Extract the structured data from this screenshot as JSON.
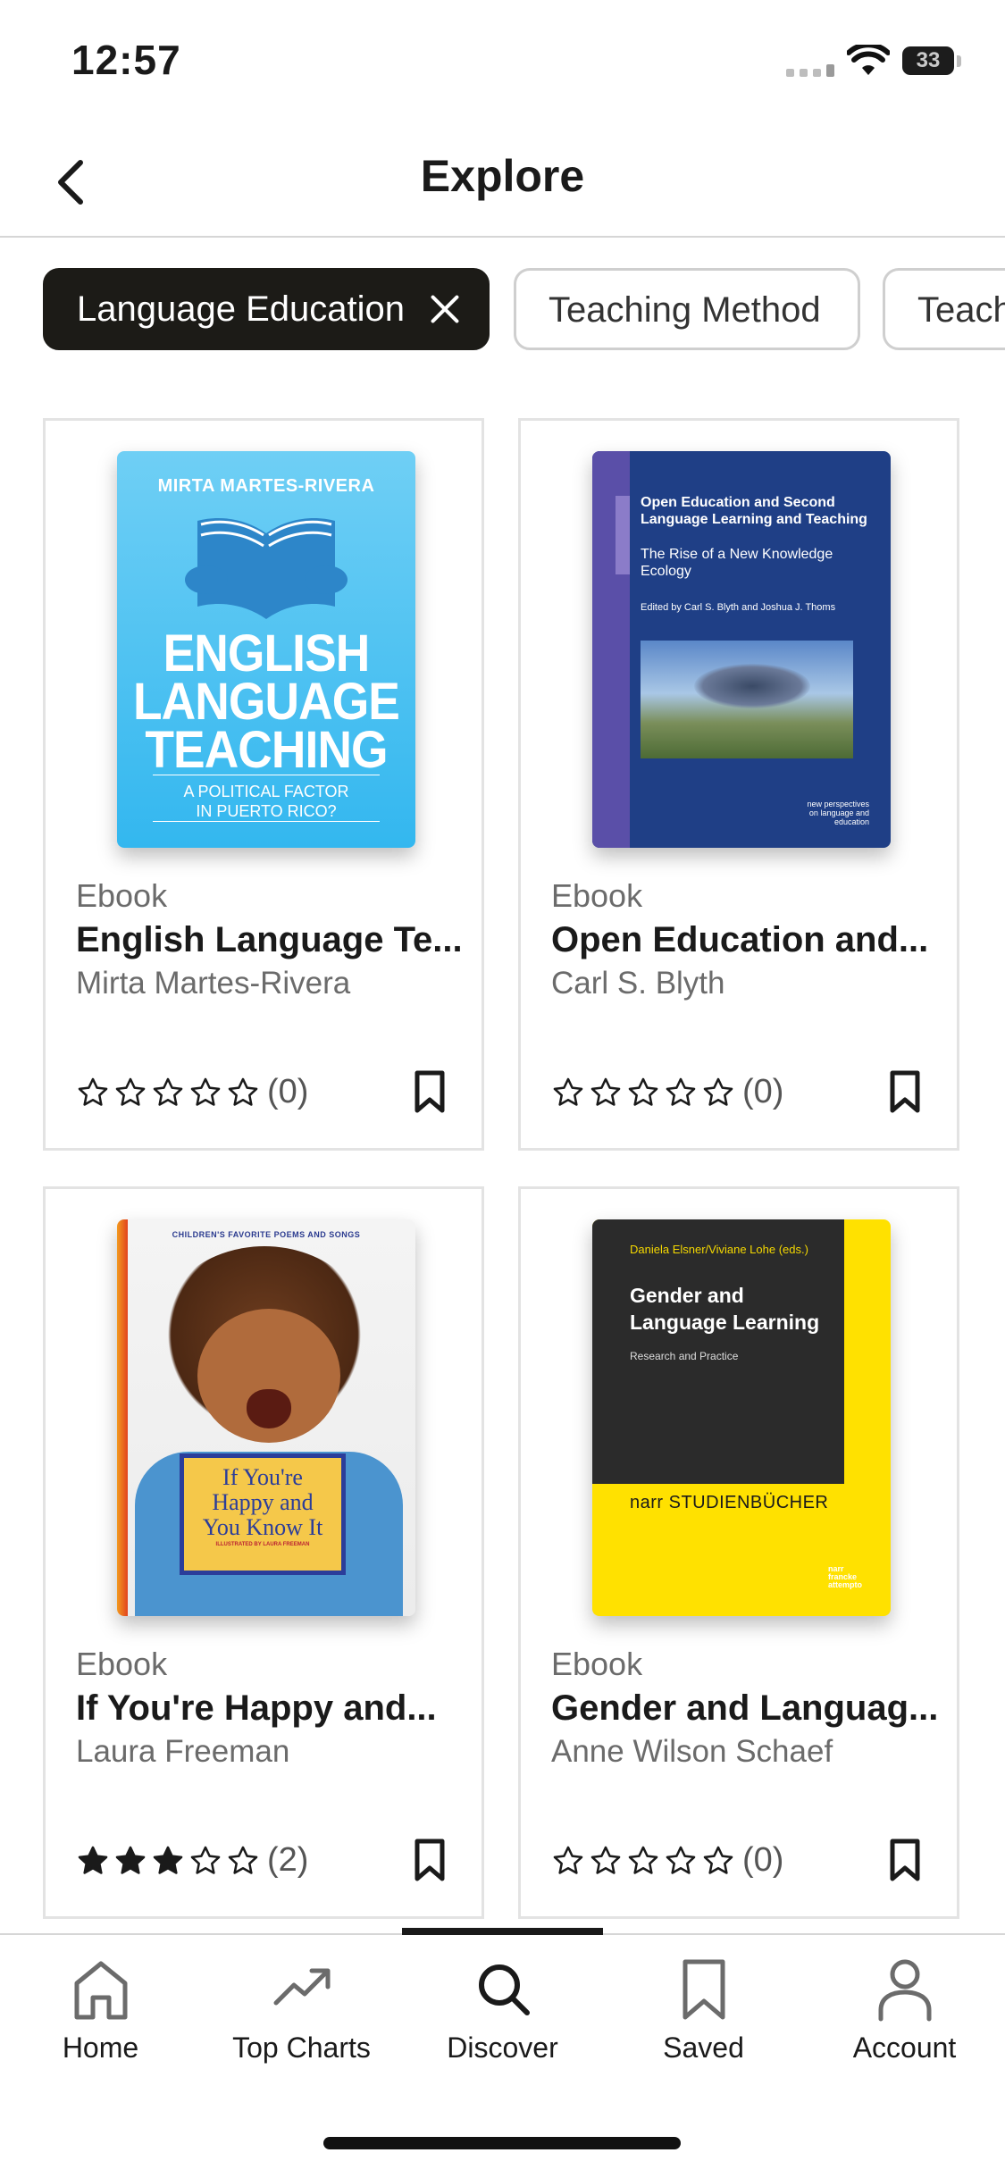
{
  "status": {
    "time": "12:57",
    "battery": "33"
  },
  "header": {
    "title": "Explore"
  },
  "filters": [
    {
      "label": "Language Education",
      "active": true
    },
    {
      "label": "Teaching Method",
      "active": false
    },
    {
      "label": "Teach",
      "active": false
    }
  ],
  "books": [
    {
      "type": "Ebook",
      "title": "English Language Te...",
      "author": "Mirta Martes-Rivera",
      "rating": 0,
      "count": "(0)",
      "cover": {
        "author": "MIRTA MARTES-RIVERA",
        "title_lines": [
          "ENGLISH",
          "LANGUAGE",
          "TEACHING"
        ],
        "subtitle_lines": [
          "A POLITICAL FACTOR",
          "IN PUERTO RICO?"
        ]
      }
    },
    {
      "type": "Ebook",
      "title": "Open Education and...",
      "author": "Carl S. Blyth",
      "rating": 0,
      "count": "(0)",
      "cover": {
        "title": "Open Education and Second Language Learning and Teaching",
        "subtitle": "The Rise of a New Knowledge Ecology",
        "editors": "Edited by Carl S. Blyth and Joshua J. Thoms",
        "series": "new perspectives on language and education"
      }
    },
    {
      "type": "Ebook",
      "title": "If You're Happy and...",
      "author": "Laura Freeman",
      "rating": 3,
      "count": "(2)",
      "cover": {
        "banner": "CHILDREN'S FAVORITE POEMS AND SONGS",
        "sign_lines": [
          "If You're",
          "Happy and",
          "You Know It"
        ],
        "illustrator": "ILLUSTRATED BY LAURA FREEMAN"
      }
    },
    {
      "type": "Ebook",
      "title": "Gender and Languag...",
      "author": "Anne Wilson Schaef",
      "rating": 0,
      "count": "(0)",
      "cover": {
        "editors": "Daniela Elsner/Viviane Lohe (eds.)",
        "title_lines": [
          "Gender and",
          "Language Learning"
        ],
        "subtitle": "Research and Practice",
        "publisher": "narr STUDIENBÜCHER",
        "logo": "narr francke attempto"
      }
    }
  ],
  "tabs": [
    {
      "label": "Home",
      "icon": "home-icon"
    },
    {
      "label": "Top Charts",
      "icon": "trending-icon"
    },
    {
      "label": "Discover",
      "icon": "search-icon",
      "active": true
    },
    {
      "label": "Saved",
      "icon": "bookmark-icon"
    },
    {
      "label": "Account",
      "icon": "person-icon"
    }
  ]
}
